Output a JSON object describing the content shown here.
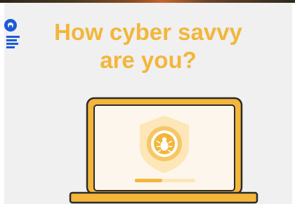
{
  "slide": {
    "title_line1": "How cyber savvy",
    "title_line2": "are you?"
  },
  "illustration": {
    "device": "laptop-icon",
    "badge": "shield-icon",
    "emblem": "bug-icon",
    "progress": 0.45
  },
  "colors": {
    "accent": "#f3b63a",
    "accent_light": "#fde6b8",
    "outline": "#2b2b2b",
    "background": "#f0f0f0",
    "screen": "#fdf6ec",
    "logo": "#1c5bd9"
  }
}
